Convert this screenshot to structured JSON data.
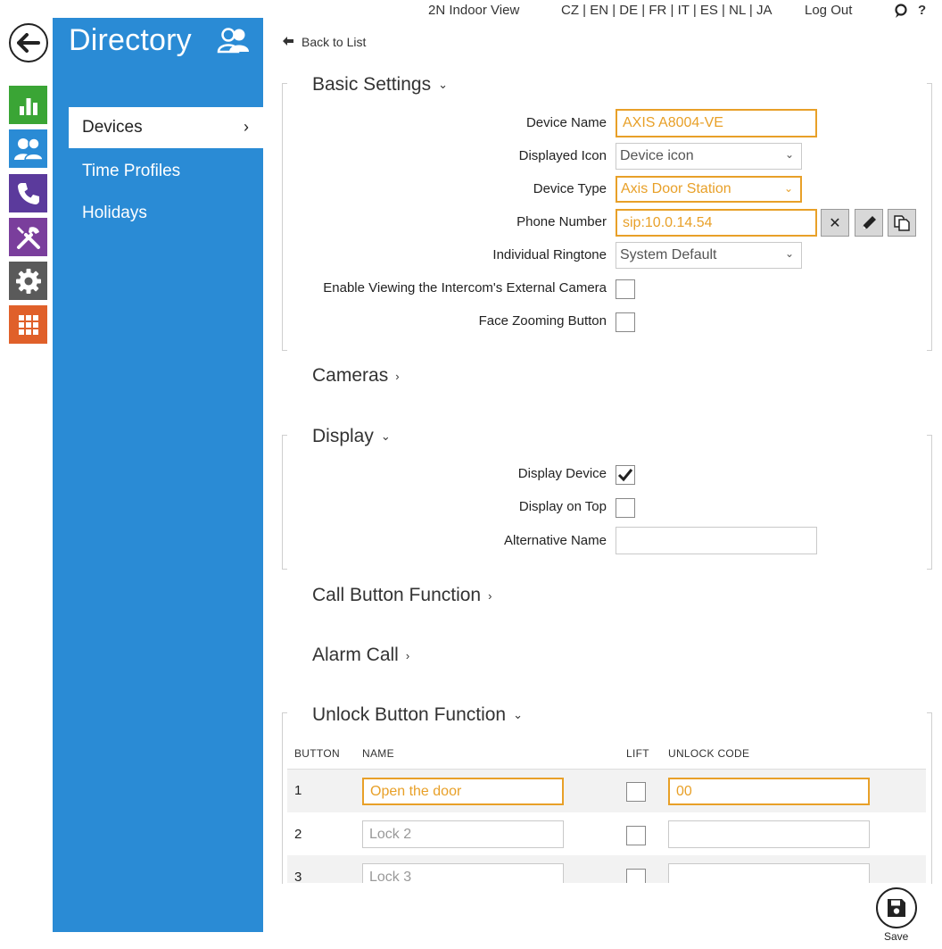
{
  "topbar": {
    "indoor_view": "2N Indoor View",
    "languages": "CZ | EN | DE | FR | IT | ES | NL | JA",
    "logout": "Log Out",
    "help": "?"
  },
  "rail": {
    "tiles": [
      {
        "icon": "bar-chart-icon",
        "color": "#3aa535"
      },
      {
        "icon": "users-icon",
        "color": "#2a8bd5"
      },
      {
        "icon": "phone-icon",
        "color": "#5b3a9c"
      },
      {
        "icon": "tools-icon",
        "color": "#7a3e9c"
      },
      {
        "icon": "gear-icon",
        "color": "#5a5a5a"
      },
      {
        "icon": "grid-icon",
        "color": "#e0602a"
      }
    ]
  },
  "sidebar": {
    "title": "Directory",
    "items": [
      {
        "label": "Devices",
        "active": true
      },
      {
        "label": "Time Profiles",
        "active": false
      },
      {
        "label": "Holidays",
        "active": false
      }
    ]
  },
  "back_link": "Back to List",
  "basic": {
    "title": "Basic Settings",
    "device_name_label": "Device Name",
    "device_name_value": "AXIS A8004-VE",
    "displayed_icon_label": "Displayed Icon",
    "displayed_icon_value": "Device icon",
    "device_type_label": "Device Type",
    "device_type_value": "Axis Door Station",
    "phone_number_label": "Phone Number",
    "phone_number_value": "sip:10.0.14.54",
    "ringtone_label": "Individual Ringtone",
    "ringtone_value": "System Default",
    "external_camera_label": "Enable Viewing the Intercom's External Camera",
    "face_zoom_label": "Face Zooming Button"
  },
  "cameras": {
    "title": "Cameras"
  },
  "display": {
    "title": "Display",
    "display_device_label": "Display Device",
    "display_device_checked": true,
    "display_on_top_label": "Display on Top",
    "display_on_top_checked": false,
    "alt_name_label": "Alternative Name",
    "alt_name_value": ""
  },
  "call_button": {
    "title": "Call Button Function"
  },
  "alarm_call": {
    "title": "Alarm Call"
  },
  "unlock": {
    "title": "Unlock Button Function",
    "headers": {
      "button": "BUTTON",
      "name": "NAME",
      "lift": "LIFT",
      "code": "UNLOCK CODE"
    },
    "rows": [
      {
        "num": "1",
        "name": "Open the door",
        "code": "00"
      },
      {
        "num": "2",
        "name": "Lock 2",
        "code": ""
      },
      {
        "num": "3",
        "name": "Lock 3",
        "code": ""
      }
    ]
  },
  "save_label": "Save",
  "accent": "#e8a028",
  "sidebar_color": "#2a8bd5"
}
